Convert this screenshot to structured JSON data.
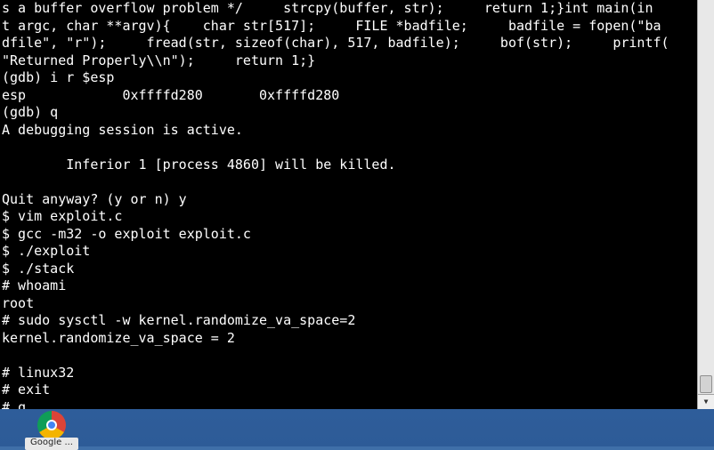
{
  "terminal": {
    "lines": [
      "s a buffer overflow problem */     strcpy(buffer, str);     return 1;}int main(in",
      "t argc, char **argv){    char str[517];     FILE *badfile;     badfile = fopen(\"ba",
      "dfile\", \"r\");     fread(str, sizeof(char), 517, badfile);     bof(str);     printf(",
      "\"Returned Properly\\\\n\");     return 1;}",
      "(gdb) i r $esp",
      "esp            0xffffd280       0xffffd280",
      "(gdb) q",
      "A debugging session is active.",
      "",
      "        Inferior 1 [process 4860] will be killed.",
      "",
      "Quit anyway? (y or n) y",
      "$ vim exploit.c",
      "$ gcc -m32 -o exploit exploit.c",
      "$ ./exploit",
      "$ ./stack",
      "# whoami",
      "root",
      "# sudo sysctl -w kernel.randomize_va_space=2",
      "kernel.randomize_va_space = 2",
      "",
      "# linux32",
      "# exit",
      "# q"
    ]
  },
  "desktop": {
    "icon_label": "Google ...",
    "icon_name": "chrome-icon"
  },
  "colors": {
    "terminal_bg": "#000000",
    "terminal_fg": "#ffffff",
    "desktop_bg": "#3f6fa8"
  }
}
